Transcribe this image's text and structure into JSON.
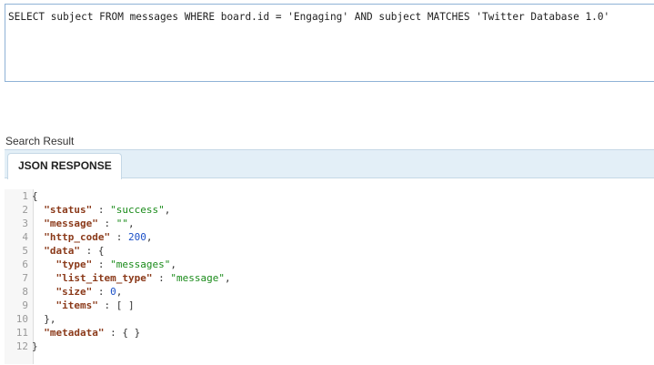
{
  "query": {
    "text": "SELECT subject FROM messages WHERE board.id = 'Engaging' AND subject MATCHES 'Twitter Database 1.0'"
  },
  "results": {
    "section_label": "Search Result",
    "tab_label": "JSON RESPONSE"
  },
  "json_response": {
    "lines": [
      {
        "num": "1",
        "indent": "",
        "segments": [
          {
            "t": "{",
            "c": "p"
          }
        ]
      },
      {
        "num": "2",
        "indent": "  ",
        "segments": [
          {
            "t": "\"status\"",
            "c": "k"
          },
          {
            "t": " : ",
            "c": "p"
          },
          {
            "t": "\"success\"",
            "c": "s"
          },
          {
            "t": ",",
            "c": "p"
          }
        ]
      },
      {
        "num": "3",
        "indent": "  ",
        "segments": [
          {
            "t": "\"message\"",
            "c": "k"
          },
          {
            "t": " : ",
            "c": "p"
          },
          {
            "t": "\"\"",
            "c": "s"
          },
          {
            "t": ",",
            "c": "p"
          }
        ]
      },
      {
        "num": "4",
        "indent": "  ",
        "segments": [
          {
            "t": "\"http_code\"",
            "c": "k"
          },
          {
            "t": " : ",
            "c": "p"
          },
          {
            "t": "200",
            "c": "n"
          },
          {
            "t": ",",
            "c": "p"
          }
        ]
      },
      {
        "num": "5",
        "indent": "  ",
        "segments": [
          {
            "t": "\"data\"",
            "c": "k"
          },
          {
            "t": " : {",
            "c": "p"
          }
        ]
      },
      {
        "num": "6",
        "indent": "    ",
        "segments": [
          {
            "t": "\"type\"",
            "c": "k"
          },
          {
            "t": " : ",
            "c": "p"
          },
          {
            "t": "\"messages\"",
            "c": "s"
          },
          {
            "t": ",",
            "c": "p"
          }
        ]
      },
      {
        "num": "7",
        "indent": "    ",
        "segments": [
          {
            "t": "\"list_item_type\"",
            "c": "k"
          },
          {
            "t": " : ",
            "c": "p"
          },
          {
            "t": "\"message\"",
            "c": "s"
          },
          {
            "t": ",",
            "c": "p"
          }
        ]
      },
      {
        "num": "8",
        "indent": "    ",
        "segments": [
          {
            "t": "\"size\"",
            "c": "k"
          },
          {
            "t": " : ",
            "c": "p"
          },
          {
            "t": "0",
            "c": "n"
          },
          {
            "t": ",",
            "c": "p"
          }
        ]
      },
      {
        "num": "9",
        "indent": "    ",
        "segments": [
          {
            "t": "\"items\"",
            "c": "k"
          },
          {
            "t": " : [ ]",
            "c": "p"
          }
        ]
      },
      {
        "num": "10",
        "indent": "  ",
        "segments": [
          {
            "t": "},",
            "c": "p"
          }
        ]
      },
      {
        "num": "11",
        "indent": "  ",
        "segments": [
          {
            "t": "\"metadata\"",
            "c": "k"
          },
          {
            "t": " : { }",
            "c": "p"
          }
        ]
      },
      {
        "num": "12",
        "indent": "",
        "segments": [
          {
            "t": "}",
            "c": "p"
          }
        ]
      }
    ]
  }
}
